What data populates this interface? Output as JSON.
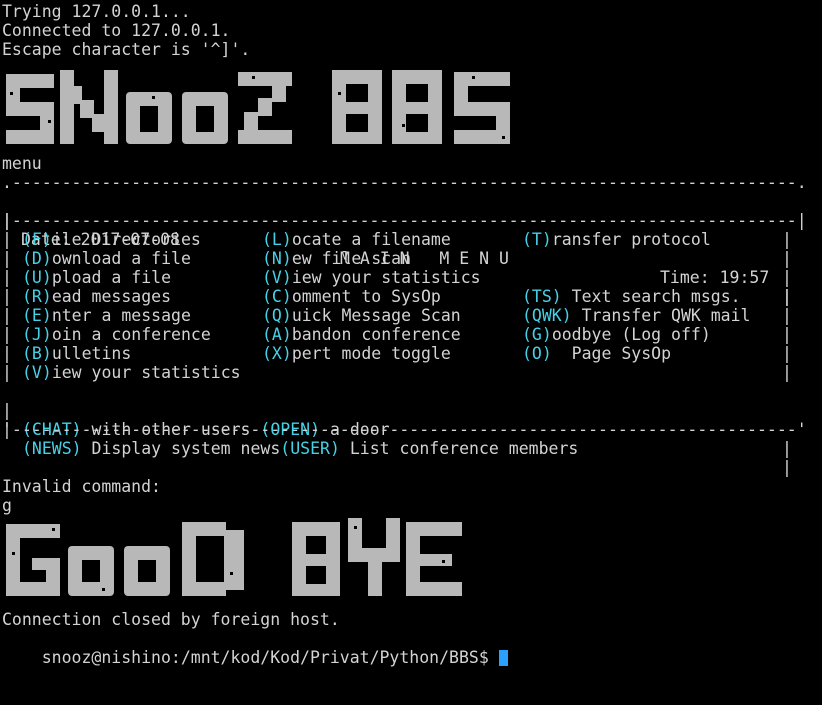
{
  "terminal": {
    "lines": [
      "Trying 127.0.0.1...",
      "Connected to 127.0.0.1.",
      "Escape character is '^]'."
    ],
    "banner_top_text": "SNooZ BBS",
    "prompt_echo": "menu"
  },
  "menu": {
    "date_label": "Date: 2017-07-08",
    "title": "M A I N   M E N U",
    "time_label": "Time: 19:57",
    "border_top": ".-------------------------------------------------------------------------------.",
    "border_bottom": "'-------------------------------------------------------------------------------'",
    "border_sep": "|-------------------------------------------------------------------------------|",
    "rows": [
      {
        "left": {
          "key": "(F)",
          "text": "ile Directories"
        },
        "mid": {
          "key": "(L)",
          "text": "ocate a filename"
        },
        "right": {
          "key": "(T)",
          "text": "ransfer protocol"
        }
      },
      {
        "left": {
          "key": "(D)",
          "text": "ownload a file"
        },
        "mid": {
          "key": "(N)",
          "text": "ew file scan"
        },
        "right": {
          "key": "",
          "text": ""
        }
      },
      {
        "left": {
          "key": "(U)",
          "text": "pload a file"
        },
        "mid": {
          "key": "(V)",
          "text": "iew your statistics"
        },
        "right": {
          "key": "",
          "text": ""
        }
      },
      {
        "left": {
          "key": "(R)",
          "text": "ead messages"
        },
        "mid": {
          "key": "(C)",
          "text": "omment to SysOp"
        },
        "right": {
          "key": "(TS)",
          "text": " Text search msgs."
        }
      },
      {
        "left": {
          "key": "(E)",
          "text": "nter a message"
        },
        "mid": {
          "key": "(Q)",
          "text": "uick Message Scan"
        },
        "right": {
          "key": "(QWK)",
          "text": " Transfer QWK mail"
        }
      },
      {
        "left": {
          "key": "(J)",
          "text": "oin a conference"
        },
        "mid": {
          "key": "(A)",
          "text": "bandon conference"
        },
        "right": {
          "key": "(G)",
          "text": "oodbye (Log off)"
        }
      },
      {
        "left": {
          "key": "(B)",
          "text": "ulletins"
        },
        "mid": {
          "key": "(X)",
          "text": "pert mode toggle"
        },
        "right": {
          "key": "(O)",
          "text": "  Page SysOp"
        }
      },
      {
        "left": {
          "key": "(V)",
          "text": "iew your statistics"
        },
        "mid": {
          "key": "",
          "text": ""
        },
        "right": {
          "key": "",
          "text": ""
        }
      }
    ],
    "chat_row": {
      "k1": "(CHAT)",
      "t1": " with other users ",
      "k2": "(OPEN)",
      "t2": " a door"
    },
    "news_row": {
      "k1": "(NEWS)",
      "t1": " Display system news",
      "k2": "(USER)",
      "t2": " List conference members"
    }
  },
  "after": {
    "error": "Invalid command:",
    "input_echo": "g",
    "banner_bottom_text": "GooD BYE",
    "closed": "Connection closed by foreign host.",
    "shell_prompt": "snooz@nishino:/mnt/kod/Kod/Privat/Python/BBS$ "
  },
  "colors": {
    "background": "#000000",
    "foreground": "#d3d3d3",
    "highlight": "#45d2e6",
    "cursor": "#2aa1ff",
    "banner": "#b8b8b8"
  }
}
